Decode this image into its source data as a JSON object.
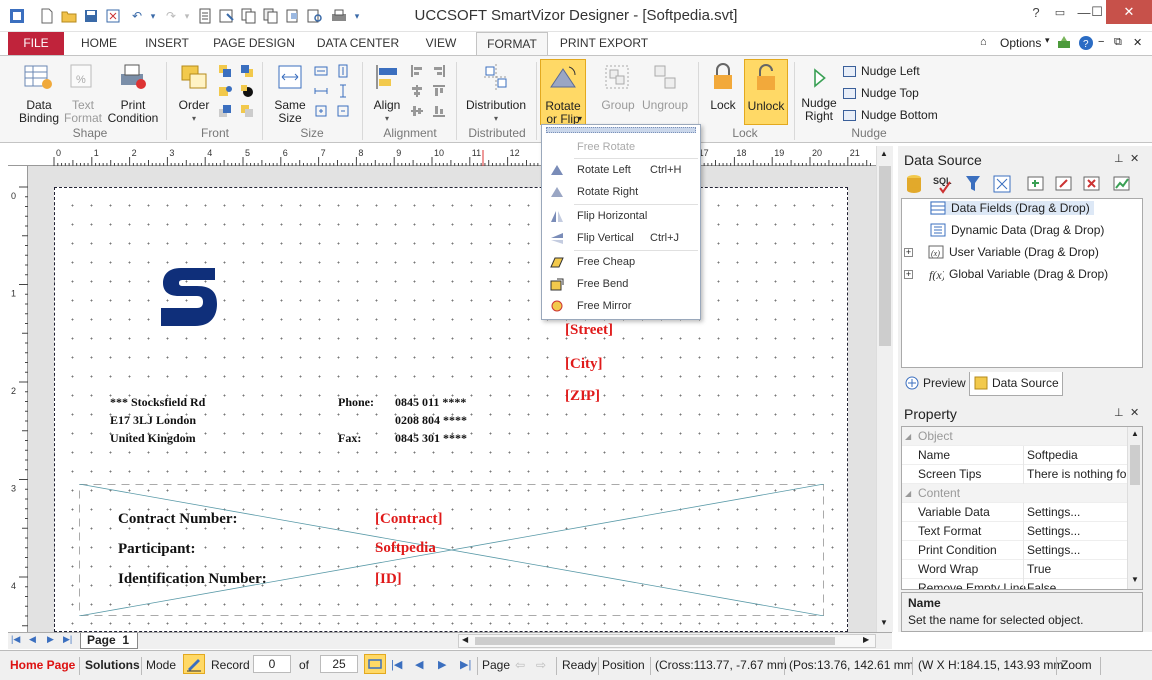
{
  "window": {
    "title": "UCCSOFT SmartVizor Designer - [Softpedia.svt]",
    "minimize": "—",
    "maximize": "☐",
    "close": "✕"
  },
  "tabs": {
    "file": "FILE",
    "home": "HOME",
    "insert": "INSERT",
    "page_design": "PAGE DESIGN",
    "data_center": "DATA CENTER",
    "view": "VIEW",
    "format": "FORMAT",
    "print_export": "PRINT EXPORT",
    "options": "Options"
  },
  "ribbon": {
    "data_binding": "Data\nBinding",
    "text_format": "Text\nFormat",
    "print_condition": "Print\nCondition",
    "group_shape": "Shape",
    "order": "Order",
    "group_front": "Front",
    "same_size": "Same\nSize",
    "group_size": "Size",
    "align": "Align",
    "group_alignment": "Alignment",
    "distribution": "Distribution",
    "group_distributed": "Distributed",
    "rotate_flip": "Rotate\nor Flip",
    "group": "Group",
    "ungroup": "Ungroup",
    "lock": "Lock",
    "unlock": "Unlock",
    "group_lock": "Lock",
    "nudge_right": "Nudge\nRight",
    "nudge_left": "Nudge Left",
    "nudge_top": "Nudge Top",
    "nudge_bottom": "Nudge Bottom",
    "group_nudge": "Nudge"
  },
  "dropdown": {
    "free_rotate": "Free Rotate",
    "rotate_left": "Rotate Left",
    "rotate_left_sc": "Ctrl+H",
    "rotate_right": "Rotate Right",
    "flip_horizontal": "Flip Horizontal",
    "flip_vertical": "Flip Vertical",
    "flip_vertical_sc": "Ctrl+J",
    "free_cheap": "Free Cheap",
    "free_bend": "Free Bend",
    "free_mirror": "Free Mirror"
  },
  "document": {
    "addr1": "*** Stocksfield Rd",
    "addr2": "E17 3LJ London",
    "addr3": "United Kingdom",
    "phone_label": "Phone:",
    "phone1": "0845 011 ****",
    "phone2": "0208 804 ****",
    "fax_label": "Fax:",
    "fax": "0845 301 ****",
    "street": "[Street]",
    "city": "[City]",
    "zip": "[ZIP]",
    "contract_label": "Contract Number:",
    "contract_val": "[Contract]",
    "participant_label": "Participant:",
    "participant_val": "Softpedia",
    "id_label": "Identification Number:",
    "id_val": "[ID]"
  },
  "ruler": {
    "h": [
      "0",
      "1",
      "2",
      "3",
      "4",
      "5",
      "6",
      "7",
      "8",
      "9",
      "10",
      "11",
      "12",
      "13",
      "14",
      "15",
      "16",
      "17",
      "18",
      "19",
      "20",
      "21"
    ],
    "v": [
      "0",
      "1",
      "2",
      "3",
      "4"
    ]
  },
  "data_source": {
    "title": "Data Source",
    "items": [
      "Data Fields (Drag & Drop)",
      "Dynamic Data (Drag & Drop)",
      "User Variable (Drag & Drop)",
      "Global Variable (Drag & Drop)"
    ],
    "tab_preview": "Preview",
    "tab_data_source": "Data Source"
  },
  "property": {
    "title": "Property",
    "rows": [
      {
        "k": "Object",
        "v": "",
        "cat": true
      },
      {
        "k": "Name",
        "v": "Softpedia"
      },
      {
        "k": "Screen Tips",
        "v": "There is nothing fo"
      },
      {
        "k": "Content",
        "v": "",
        "cat": true
      },
      {
        "k": "Variable Data",
        "v": "Settings..."
      },
      {
        "k": "Text Format",
        "v": "Settings..."
      },
      {
        "k": "Print Condition",
        "v": "Settings..."
      },
      {
        "k": "Word Wrap",
        "v": "True"
      },
      {
        "k": "Remove Empty Line",
        "v": "False"
      }
    ],
    "desc_title": "Name",
    "desc_text": "Set the name for selected object."
  },
  "pagebar": {
    "page_tab": "Page  1"
  },
  "status": {
    "home_page": "Home Page",
    "solutions": "Solutions",
    "mode": "Mode",
    "record": "Record",
    "record_val": "0",
    "of": "of",
    "total": "25",
    "page": "Page",
    "ready": "Ready",
    "position": "Position",
    "cross": "(Cross:113.77, -7.67 mm",
    "pos": "(Pos:13.76, 142.61 mm",
    "wh": "(W X H:184.15, 143.93 mm",
    "zoom": "Zoom"
  },
  "colors": {
    "file_tab": "#c0233b",
    "accent": "#2b579a",
    "field_red": "#e01a1a",
    "logo_blue": "#0f2f7a"
  }
}
